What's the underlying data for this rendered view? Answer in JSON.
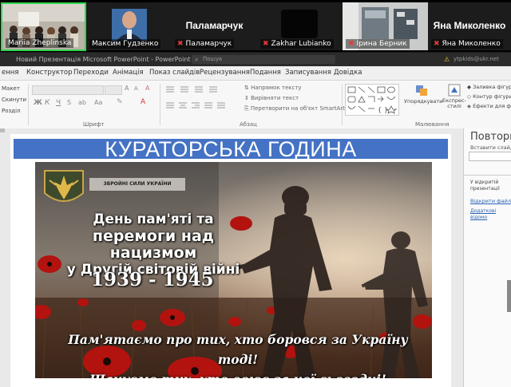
{
  "participants": [
    {
      "name": "Mariia Zheplinska",
      "muted": false
    },
    {
      "name": "Максим Гудзенко",
      "muted": false
    },
    {
      "name": "Паламарчук",
      "display": "Паламарчук",
      "muted": true
    },
    {
      "name": "Zakhar Lubianko",
      "muted": true
    },
    {
      "name": "Ірина Берник",
      "muted": true
    },
    {
      "name": "Яна Миколенко",
      "display": "Яна Миколенко",
      "muted": true
    }
  ],
  "window": {
    "title": "Новий Презентація Microsoft PowerPoint  -  PowerPoint",
    "search_placeholder": "Пошук",
    "user": "ytpkids@ukr.net"
  },
  "tabs": [
    "ення",
    "Конструктор",
    "Переходи",
    "Анімація",
    "Показ слайдів",
    "Рецензування",
    "Подання",
    "Записування",
    "Довідка"
  ],
  "ribbon": {
    "slides_group": [
      "Макет",
      "Скинути",
      "Розділ"
    ],
    "font_group_label": "Шрифт",
    "paragraph_group_label": "Абзац",
    "paragraph_buttons": [
      "Напрямок тексту",
      "Вирівняти текст",
      "Перетворити на об'єкт SmartArt"
    ],
    "drawing_group_label": "Малювання",
    "arrange_label": "Упорядкувати",
    "quick_styles_label": "Експрес-стилі",
    "shape_options": [
      "Заливка фігури",
      "Контур фігури",
      "Ефекти для фігур"
    ]
  },
  "slide": {
    "title": "КУРАТОРСЬКА ГОДИНА",
    "emblem_text": "ЗБРОЙНІ СИЛИ УКРАЇНИ",
    "headline_lines": [
      "День пам'яті та",
      "перемоги над нацизмом",
      "у Другій світовій війні"
    ],
    "years": "1939 - 1945",
    "slogan_lines": [
      "Пам'ятаємо про тих, хто боровся за Україну тоді!",
      "Шануємо тих, хто воює за неї сьогодні!"
    ]
  },
  "side_panel": {
    "title": "Повторне",
    "insert_label": "Вставити слайд і",
    "text1": "У відкритій презентації використани сл",
    "link1": "Відкрити файл",
    "link2": "Додаткові відомо використання з"
  }
}
